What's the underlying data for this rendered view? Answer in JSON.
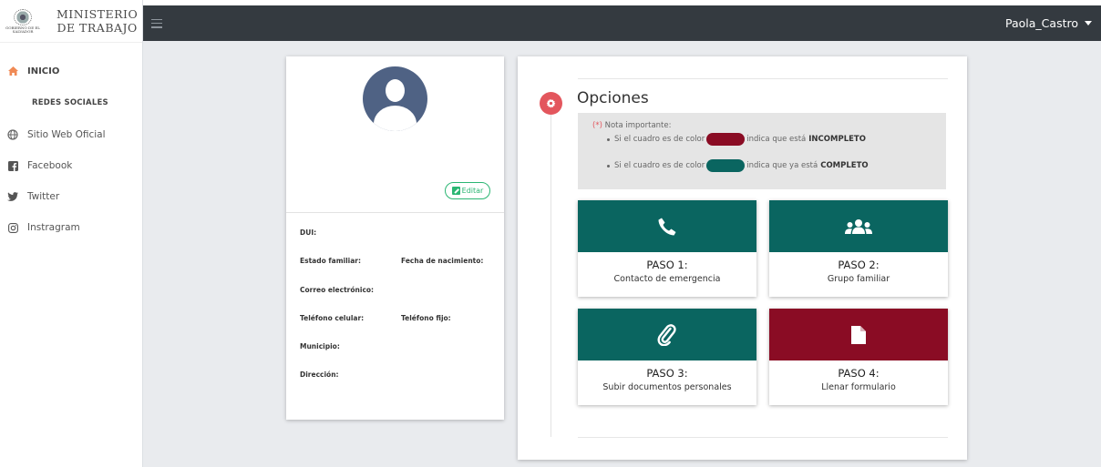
{
  "brand": {
    "line1": "MINISTERIO",
    "line2": "DE TRABAJO",
    "seal_caption": "GOBIERNO DE EL SALVADOR"
  },
  "topbar": {
    "user": "Paola_Castro"
  },
  "sidebar": {
    "home": "INICIO",
    "heading": "REDES SOCIALES",
    "items": [
      {
        "label": "Sitio Web Oficial",
        "icon": "globe-icon"
      },
      {
        "label": "Facebook",
        "icon": "facebook-icon"
      },
      {
        "label": "Twitter",
        "icon": "twitter-icon"
      },
      {
        "label": "Instragram",
        "icon": "instagram-icon"
      }
    ]
  },
  "profile": {
    "edit_label": "Editar",
    "dui": "DUI:",
    "estado": "Estado familiar:",
    "nacimiento": "Fecha de nacimiento:",
    "correo": "Correo electrónico:",
    "celular": "Teléfono celular:",
    "fijo": "Teléfono fijo:",
    "municipio": "Municipio:",
    "direccion": "Dirección:"
  },
  "options": {
    "title": "Opciones",
    "note_mark": "(*)",
    "note_title": "Nota importante:",
    "line1_pre": "Si el cuadro es de color",
    "line1_post": "indica que está",
    "line1_strong": "INCOMPLETO",
    "line2_pre": "Si el cuadro es de color",
    "line2_post": "indica que ya está",
    "line2_strong": "COMPLETO",
    "steps": [
      {
        "label": "PASO 1:",
        "sub": "Contacto de emergencia",
        "icon": "phone-icon",
        "status": "complete"
      },
      {
        "label": "PASO 2:",
        "sub": "Grupo familiar",
        "icon": "users-icon",
        "status": "complete"
      },
      {
        "label": "PASO 3:",
        "sub": "Subir documentos personales",
        "icon": "paperclip-icon",
        "status": "complete"
      },
      {
        "label": "PASO 4:",
        "sub": "Llenar formulario",
        "icon": "file-icon",
        "status": "incomplete"
      }
    ]
  },
  "colors": {
    "complete": "#0a6560",
    "incomplete": "#8a0c24",
    "accent": "#e3565d",
    "topbar": "#343a40"
  }
}
